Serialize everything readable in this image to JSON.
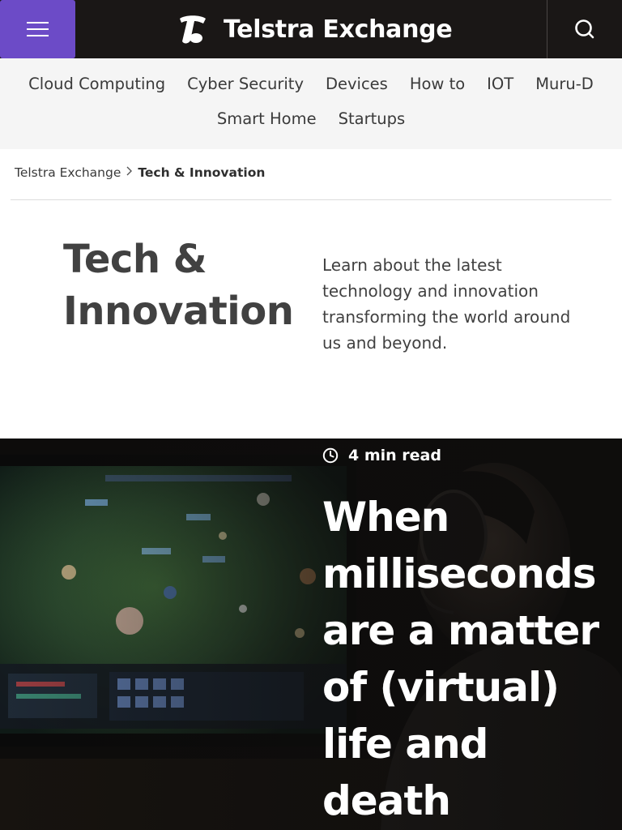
{
  "header": {
    "brand_name": "Telstra Exchange",
    "menu_icon": "hamburger-icon",
    "logo_icon": "telstra-t-logo",
    "search_icon": "search-icon",
    "brand_color": "#6c4bc7"
  },
  "categories": [
    "Cloud Computing",
    "Cyber Security",
    "Devices",
    "How to",
    "IOT",
    "Muru-D",
    "Smart Home",
    "Startups"
  ],
  "breadcrumb": {
    "home": "Telstra Exchange",
    "separator_icon": "chevron-right-icon",
    "current": "Tech & Innovation"
  },
  "intro": {
    "title": "Tech & Innovation",
    "description": "Learn about the latest technology and innovation transforming the world around us and beyond."
  },
  "feature": {
    "read_time": "4 min read",
    "clock_icon": "clock-icon",
    "title": "When milliseconds are a matter of (virtual) life and death"
  }
}
